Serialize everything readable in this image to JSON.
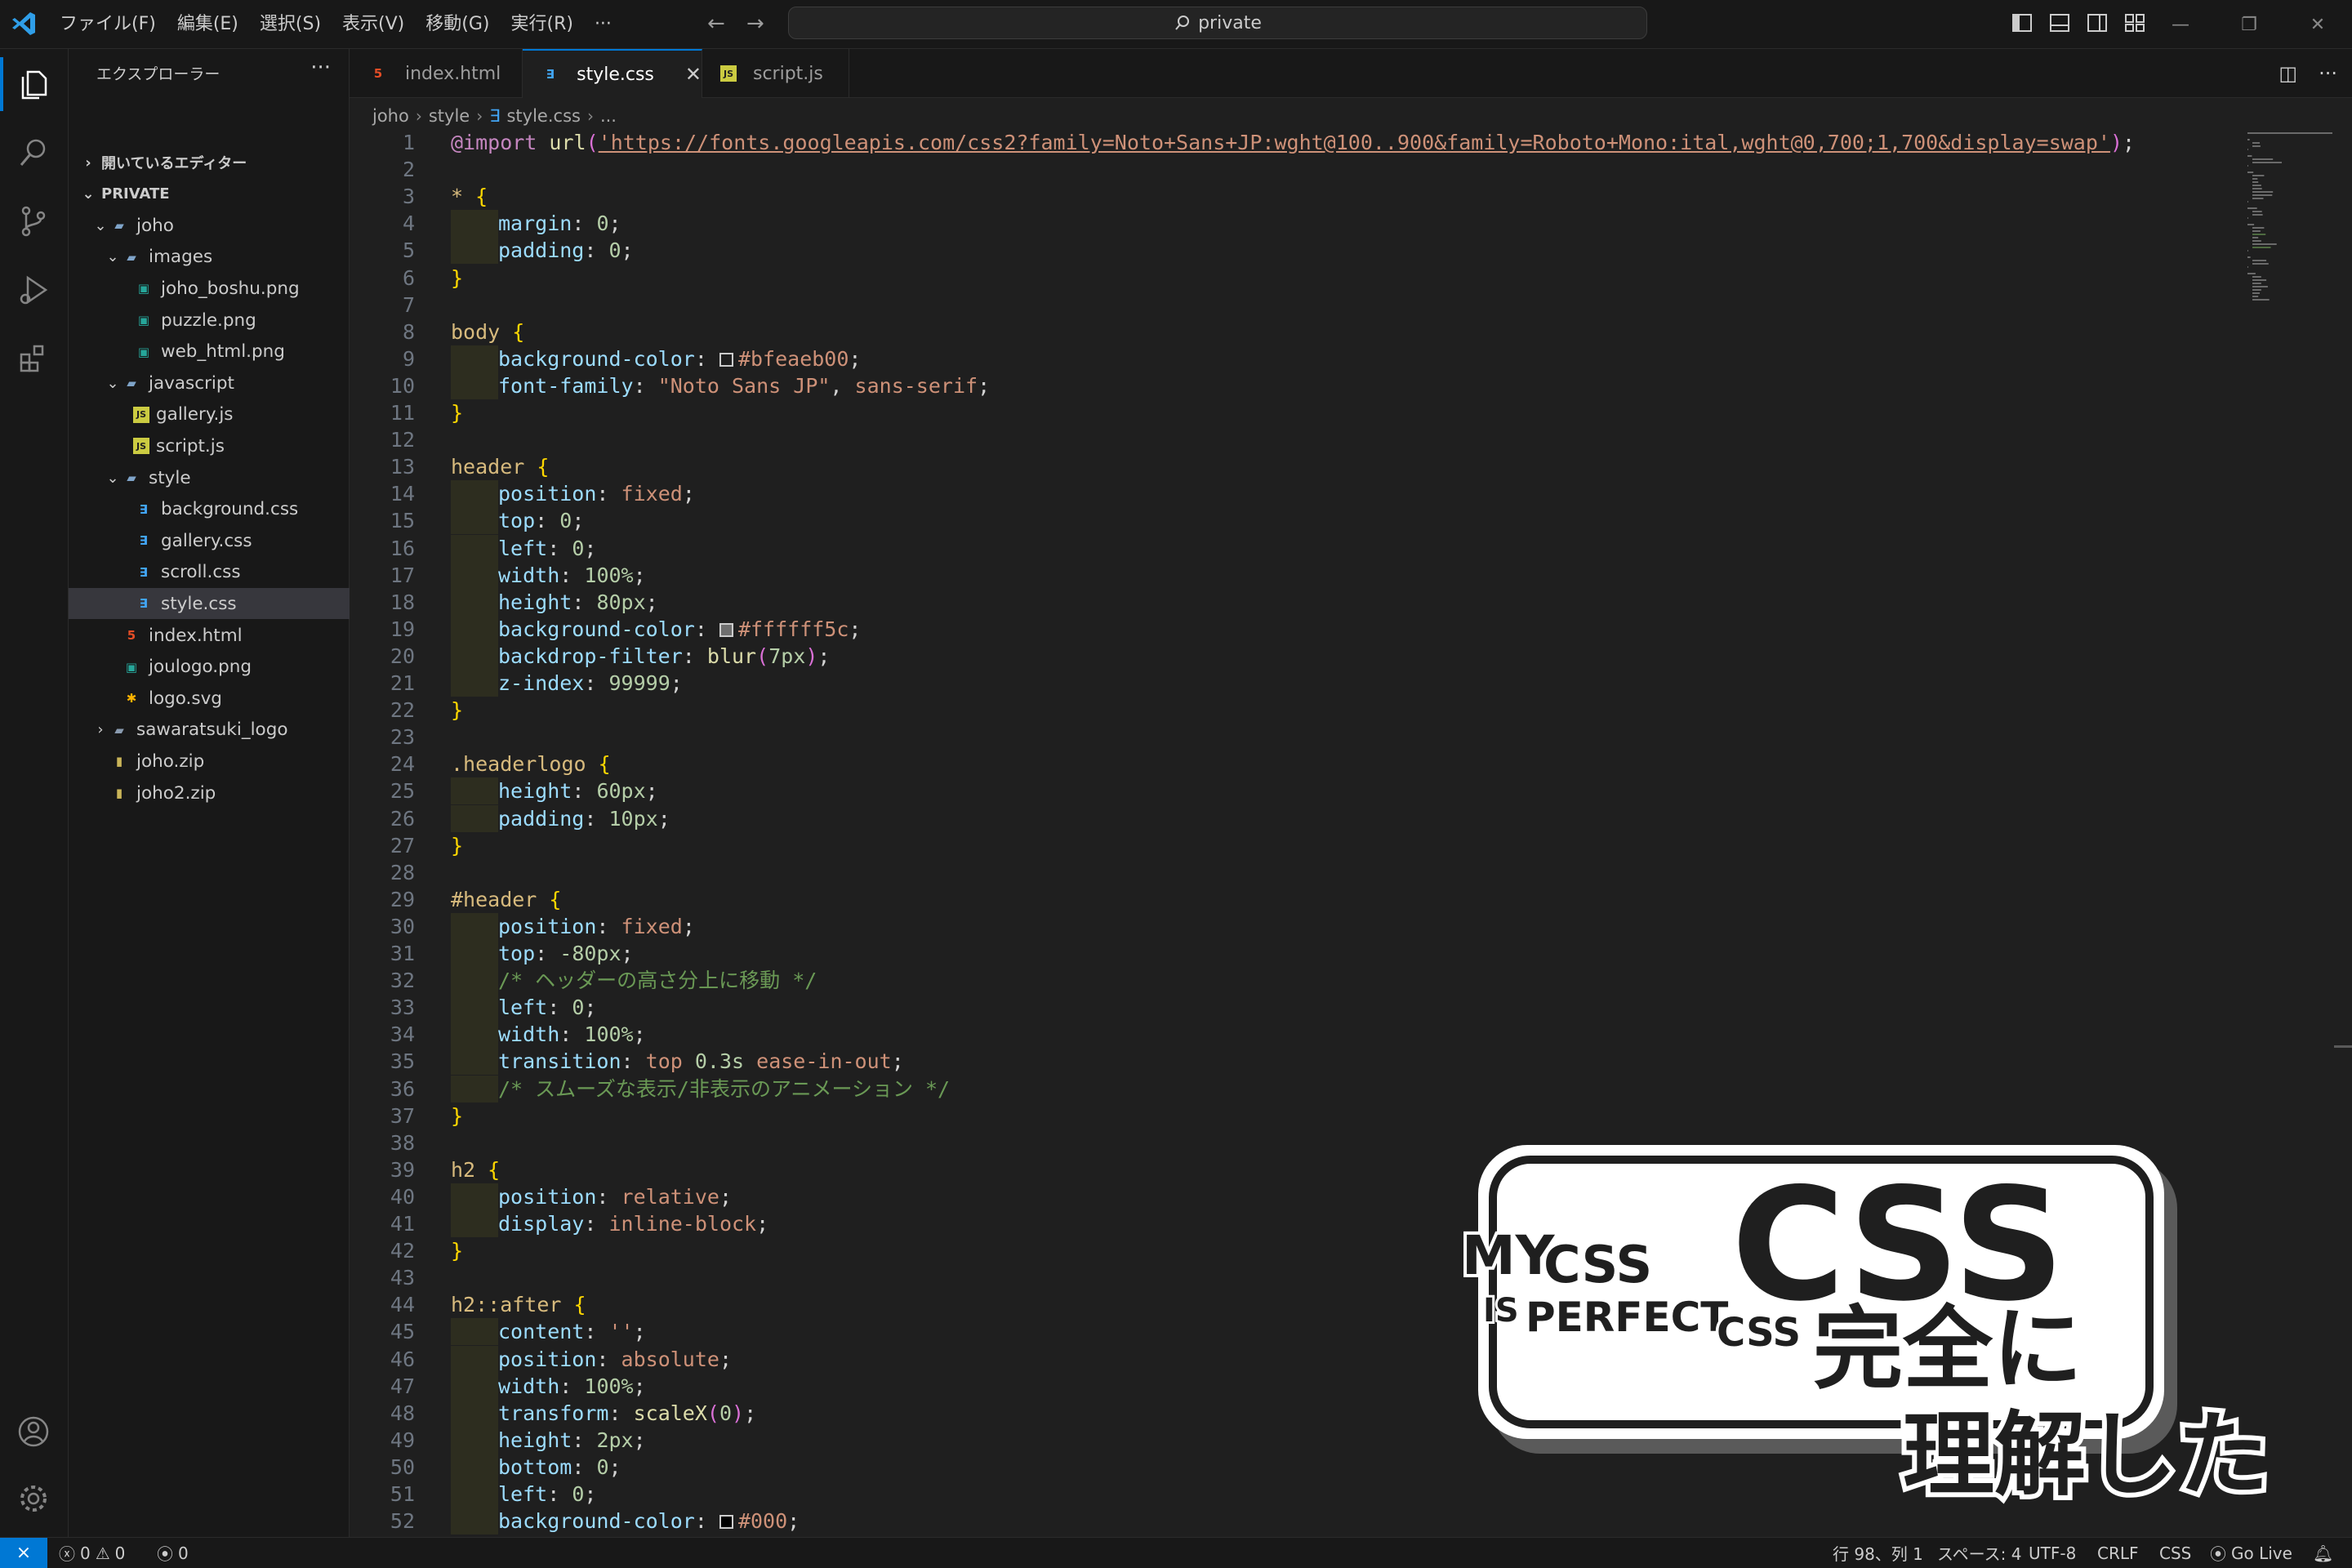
{
  "menubar": [
    "ファイル(F)",
    "編集(E)",
    "選択(S)",
    "表示(V)",
    "移動(G)",
    "実行(R)",
    "···"
  ],
  "search": {
    "text": "private"
  },
  "sidebar": {
    "title": "エクスプローラー",
    "more": "···",
    "open_editors": "開いているエディター",
    "root": "PRIVATE",
    "tree": [
      {
        "label": "joho",
        "type": "folder-open"
      },
      {
        "label": "images",
        "type": "folder-open"
      },
      {
        "label": "joho_boshu.png",
        "type": "image"
      },
      {
        "label": "puzzle.png",
        "type": "image"
      },
      {
        "label": "web_html.png",
        "type": "image"
      },
      {
        "label": "javascript",
        "type": "folder-open"
      },
      {
        "label": "gallery.js",
        "type": "js"
      },
      {
        "label": "script.js",
        "type": "js"
      },
      {
        "label": "style",
        "type": "folder-open"
      },
      {
        "label": "background.css",
        "type": "css"
      },
      {
        "label": "gallery.css",
        "type": "css"
      },
      {
        "label": "scroll.css",
        "type": "css"
      },
      {
        "label": "style.css",
        "type": "css"
      },
      {
        "label": "index.html",
        "type": "html"
      },
      {
        "label": "joulogo.png",
        "type": "image"
      },
      {
        "label": "logo.svg",
        "type": "svg"
      },
      {
        "label": "sawaratsuki_logo",
        "type": "folder"
      },
      {
        "label": "joho.zip",
        "type": "zip"
      },
      {
        "label": "joho2.zip",
        "type": "zip"
      }
    ]
  },
  "tabs": [
    {
      "label": "index.html",
      "icon": "html-file-icon"
    },
    {
      "label": "style.css",
      "icon": "css-file-icon"
    },
    {
      "label": "script.js",
      "icon": "js-file-icon"
    }
  ],
  "tab_close": "✕",
  "breadcrumb": [
    "joho",
    "style",
    "style.css",
    "..."
  ],
  "code_lines": [
    "@import url('https://fonts.googleapis.com/css2?family=Noto+Sans+JP:wght@100..900&family=Roboto+Mono:ital,wght@0,700;1,700&display=swap');",
    "",
    "* {",
    "    margin: 0;",
    "    padding: 0;",
    "}",
    "",
    "body {",
    "    background-color: #bfeaeb00;",
    "    font-family: \"Noto Sans JP\", sans-serif;",
    "}",
    "",
    "header {",
    "    position: fixed;",
    "    top: 0;",
    "    left: 0;",
    "    width: 100%;",
    "    height: 80px;",
    "    background-color: #ffffff5c;",
    "    backdrop-filter: blur(7px);",
    "    z-index: 99999;",
    "}",
    "",
    ".headerlogo {",
    "    height: 60px;",
    "    padding: 10px;",
    "}",
    "",
    "#header {",
    "    position: fixed;",
    "    top: -80px;",
    "    /* ヘッダーの高さ分上に移動 */",
    "    left: 0;",
    "    width: 100%;",
    "    transition: top 0.3s ease-in-out;",
    "    /* スムーズな表示/非表示のアニメーション */",
    "}",
    "",
    "h2 {",
    "    position: relative;",
    "    display: inline-block;",
    "}",
    "",
    "h2::after {",
    "    content: '';",
    "    position: absolute;",
    "    width: 100%;",
    "    transform: scaleX(0);",
    "    height: 2px;",
    "    bottom: 0;",
    "    left: 0;",
    "    background-color: #000;"
  ],
  "status": {
    "errors": "0",
    "warnings": "0",
    "ports": "0",
    "position": "行 98、列 1",
    "spaces": "スペース: 4",
    "encoding": "UTF-8",
    "eol": "CRLF",
    "language": "CSS",
    "golive": "Go Live"
  },
  "sticker": {
    "big": "CSS",
    "my": "MY",
    "css_small": "CSS",
    "is": "IS",
    "perfect": "PERFECT",
    "css_tail": "CSS",
    "line1": "完全に",
    "line2": "理解した"
  },
  "colors": {
    "accent": "#0078d4",
    "background": "#1f1f1f",
    "sidebar": "#181818"
  }
}
